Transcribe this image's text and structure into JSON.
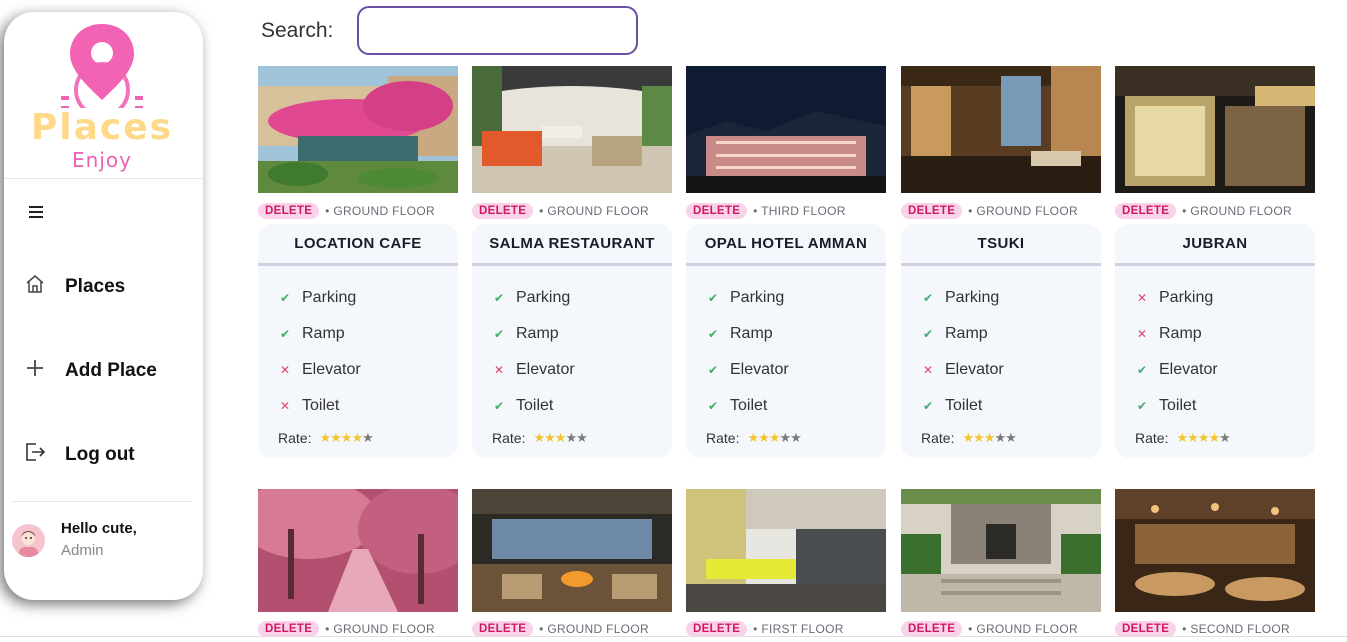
{
  "app": {
    "logo_title": "Places",
    "logo_subtitle": "Enjoy",
    "brand_pink": "#f263b3",
    "brand_yellow": "#ffd98a"
  },
  "sidebar": {
    "menu_icon": "hamburger-icon",
    "items": [
      {
        "label": "Places",
        "icon": "home-icon"
      },
      {
        "label": "Add Place",
        "icon": "plus-icon"
      },
      {
        "label": "Log out",
        "icon": "logout-icon"
      }
    ],
    "user": {
      "greeting": "Hello cute,",
      "role": "Admin"
    }
  },
  "search": {
    "label": "Search:",
    "value": "",
    "placeholder": ""
  },
  "cards": [
    {
      "name": "LOCATION CAFE",
      "floor": "GROUND FLOOR",
      "delete_label": "DELETE",
      "features": [
        {
          "label": "Parking",
          "ok": true
        },
        {
          "label": "Ramp",
          "ok": true
        },
        {
          "label": "Elevator",
          "ok": false
        },
        {
          "label": "Toilet",
          "ok": false
        }
      ],
      "rate_label": "Rate:",
      "rating": 4
    },
    {
      "name": "SALMA RESTAURANT",
      "floor": "GROUND FLOOR",
      "delete_label": "DELETE",
      "features": [
        {
          "label": "Parking",
          "ok": true
        },
        {
          "label": "Ramp",
          "ok": true
        },
        {
          "label": "Elevator",
          "ok": false
        },
        {
          "label": "Toilet",
          "ok": true
        }
      ],
      "rate_label": "Rate:",
      "rating": 3
    },
    {
      "name": "OPAL HOTEL AMMAN",
      "floor": "THIRD FLOOR",
      "delete_label": "DELETE",
      "features": [
        {
          "label": "Parking",
          "ok": true
        },
        {
          "label": "Ramp",
          "ok": true
        },
        {
          "label": "Elevator",
          "ok": true
        },
        {
          "label": "Toilet",
          "ok": true
        }
      ],
      "rate_label": "Rate:",
      "rating": 3
    },
    {
      "name": "TSUKI",
      "floor": "GROUND FLOOR",
      "delete_label": "DELETE",
      "features": [
        {
          "label": "Parking",
          "ok": true
        },
        {
          "label": "Ramp",
          "ok": true
        },
        {
          "label": "Elevator",
          "ok": false
        },
        {
          "label": "Toilet",
          "ok": true
        }
      ],
      "rate_label": "Rate:",
      "rating": 3
    },
    {
      "name": "JUBRAN",
      "floor": "GROUND FLOOR",
      "delete_label": "DELETE",
      "features": [
        {
          "label": "Parking",
          "ok": false
        },
        {
          "label": "Ramp",
          "ok": false
        },
        {
          "label": "Elevator",
          "ok": true
        },
        {
          "label": "Toilet",
          "ok": true
        }
      ],
      "rate_label": "Rate:",
      "rating": 4
    }
  ],
  "cards_row2": [
    {
      "floor": "GROUND FLOOR",
      "delete_label": "DELETE"
    },
    {
      "floor": "GROUND FLOOR",
      "delete_label": "DELETE"
    },
    {
      "floor": "FIRST FLOOR",
      "delete_label": "DELETE"
    },
    {
      "floor": "GROUND FLOOR",
      "delete_label": "DELETE"
    },
    {
      "floor": "SECOND FLOOR",
      "delete_label": "DELETE"
    }
  ]
}
